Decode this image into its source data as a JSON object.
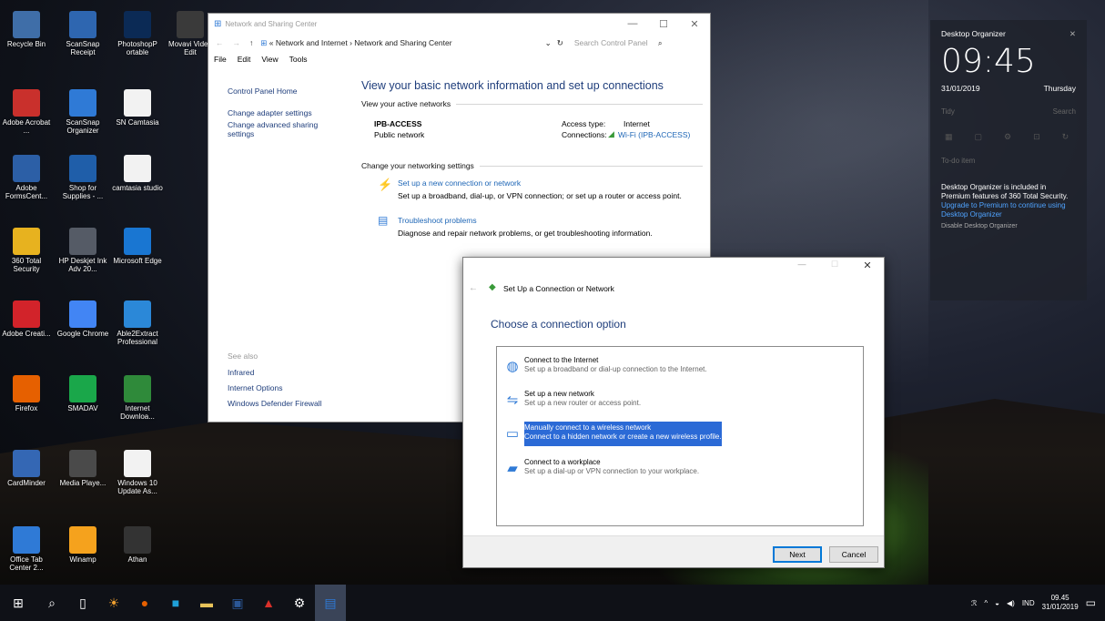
{
  "desktop_icons": [
    {
      "label": "Recycle Bin",
      "color": "#3f6ea8"
    },
    {
      "label": "ScanSnap Receipt",
      "color": "#2e66b0"
    },
    {
      "label": "PhotoshopP ortable",
      "color": "#0b2a55"
    },
    {
      "label": "Movavi Video Edit",
      "color": "#3a3a3a"
    },
    {
      "label": "Adobe Acrobat ...",
      "color": "#c9302c"
    },
    {
      "label": "ScanSnap Organizer",
      "color": "#2f7ad6"
    },
    {
      "label": "SN Camtasia",
      "color": "#f2f2f2"
    },
    {
      "label": "Adobe FormsCent...",
      "color": "#2c5fa6"
    },
    {
      "label": "Shop for Supplies - ...",
      "color": "#1f5ea9"
    },
    {
      "label": "camtasia studio",
      "color": "#f2f2f2"
    },
    {
      "label": "360 Total Security",
      "color": "#e7b21f"
    },
    {
      "label": "HP Deskjet Ink Adv 20...",
      "color": "#555b66"
    },
    {
      "label": "Microsoft Edge",
      "color": "#1976d2"
    },
    {
      "label": "Adobe Creati...",
      "color": "#d2232a"
    },
    {
      "label": "Google Chrome",
      "color": "#4285f4"
    },
    {
      "label": "Able2Extract Professional",
      "color": "#2b88d8"
    },
    {
      "label": "Firefox",
      "color": "#e66000"
    },
    {
      "label": "SMADAV",
      "color": "#1aa74a"
    },
    {
      "label": "Internet Downloa...",
      "color": "#2f8a3a"
    },
    {
      "label": "CardMinder",
      "color": "#3467b4"
    },
    {
      "label": "Media Playe...",
      "color": "#4a4a4a"
    },
    {
      "label": "Windows 10 Update As...",
      "color": "#f2f2f2"
    },
    {
      "label": "Office Tab Center 2...",
      "color": "#2f7ad6"
    },
    {
      "label": "Winamp",
      "color": "#f5a21d"
    },
    {
      "label": "Athan",
      "color": "#333333"
    }
  ],
  "net_window": {
    "title": "Network and Sharing Center",
    "breadcrumb_1": "Network and Internet",
    "breadcrumb_2": "Network and Sharing Center",
    "search_placeholder": "Search Control Panel",
    "menu": [
      "File",
      "Edit",
      "View",
      "Tools"
    ],
    "left_links": [
      "Control Panel Home",
      "Change adapter settings",
      "Change advanced sharing settings"
    ],
    "see_also_label": "See also",
    "see_also": [
      "Infrared",
      "Internet Options",
      "Windows Defender Firewall"
    ],
    "heading": "View your basic network information and set up connections",
    "active_networks_label": "View your active networks",
    "network_name": "IPB-ACCESS",
    "network_type": "Public network",
    "access_type_label": "Access type:",
    "access_type_value": "Internet",
    "connections_label": "Connections:",
    "connections_value": "Wi-Fi (IPB-ACCESS)",
    "change_settings_label": "Change your networking settings",
    "setup_link": "Set up a new connection or network",
    "setup_desc": "Set up a broadband, dial-up, or VPN connection; or set up a router or access point.",
    "troubleshoot_link": "Troubleshoot problems",
    "troubleshoot_desc": "Diagnose and repair network problems, or get troubleshooting information."
  },
  "dialog": {
    "title": "Set Up a Connection or Network",
    "heading": "Choose a connection option",
    "options": [
      {
        "title": "Connect to the Internet",
        "desc": "Set up a broadband or dial-up connection to the Internet."
      },
      {
        "title": "Set up a new network",
        "desc": "Set up a new router or access point."
      },
      {
        "title": "Manually connect to a wireless network",
        "desc": "Connect to a hidden network or create a new wireless profile."
      },
      {
        "title": "Connect to a workplace",
        "desc": "Set up a dial-up or VPN connection to your workplace."
      }
    ],
    "next_label": "Next",
    "cancel_label": "Cancel"
  },
  "organizer": {
    "title": "Desktop Organizer",
    "time": "09:45",
    "date": "31/01/2019",
    "day": "Thursday",
    "tidy": "Tidy",
    "search": "Search",
    "todo": "To-do item",
    "info": "Desktop Organizer is included in Premium features of 360 Total Security.",
    "upgrade": "Upgrade to Premium to continue using Desktop Organizer",
    "disable": "Disable Desktop Organizer"
  },
  "taskbar": {
    "lang": "IND",
    "time": "09.45",
    "date": "31/01/2019"
  }
}
